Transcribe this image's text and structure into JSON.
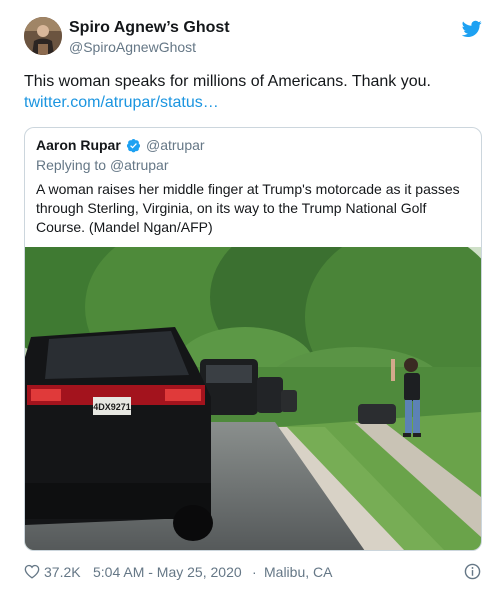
{
  "tweet": {
    "display_name": "Spiro Agnew’s Ghost",
    "handle": "@SpiroAgnewGhost",
    "text": "This woman speaks for millions of Americans. Thank you.",
    "link": "twitter.com/atrupar/status…",
    "avatar_icon": "portrait-avatar",
    "brand_icon": "twitter-bird-icon",
    "brand_color": "#1da1f2"
  },
  "quoted": {
    "display_name": "Aaron Rupar",
    "handle": "@atrupar",
    "verified_icon": "verified-badge-icon",
    "replying_prefix": "Replying to",
    "replying_handle": "@atrupar",
    "text": "A woman raises her middle finger at Trump's motorcade as it passes through Sterling, Virginia, on its way to the Trump National Golf Course. (Mandel Ngan/AFP)",
    "photo": {
      "plate": "4DX9271"
    }
  },
  "footer": {
    "like_icon": "heart-icon",
    "likes": "37.2K",
    "timestamp": "5:04 AM - May 25, 2020",
    "separator": "·",
    "location": "Malibu, CA",
    "info_icon": "info-icon"
  }
}
